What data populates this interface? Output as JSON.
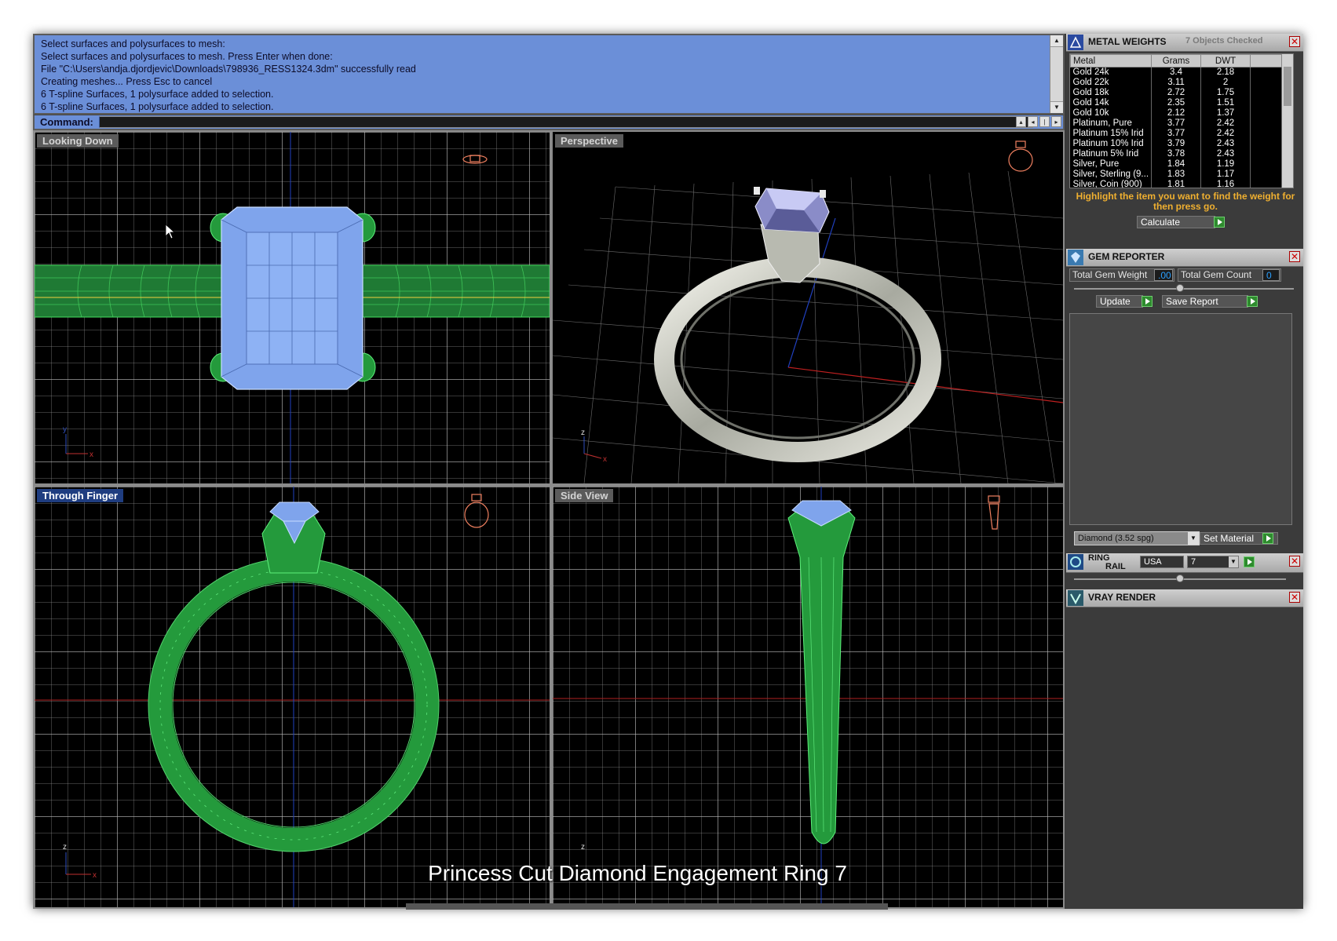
{
  "command_history": {
    "lines": [
      "Select surfaces and polysurfaces to mesh:",
      "Select surfaces and polysurfaces to mesh. Press Enter when done:",
      "File \"C:\\Users\\andja.djordjevic\\Downloads\\798936_RESS1324.3dm\" successfully read",
      "Creating meshes... Press Esc to cancel",
      "6 T-spline Surfaces, 1 polysurface added to selection.",
      "6 T-spline Surfaces, 1 polysurface added to selection."
    ]
  },
  "command_line": {
    "label": "Command:",
    "value": ""
  },
  "viewports": {
    "top": {
      "title": "Looking Down",
      "axis_x": "x",
      "axis_y": "y"
    },
    "perspective": {
      "title": "Perspective",
      "axis_x": "x",
      "axis_y": "z"
    },
    "front": {
      "title": "Through Finger",
      "axis_x": "x",
      "axis_y": "z",
      "active": true
    },
    "side": {
      "title": "Side View",
      "axis_y": "z"
    }
  },
  "caption": "Princess Cut Diamond Engagement Ring  7",
  "metal_weights": {
    "title": "METAL WEIGHTS",
    "status": "7 Objects Checked",
    "columns": [
      "Metal",
      "Grams",
      "DWT"
    ],
    "rows": [
      [
        "Gold 24k",
        "3.4",
        "2.18"
      ],
      [
        "Gold 22k",
        "3.11",
        "2"
      ],
      [
        "Gold 18k",
        "2.72",
        "1.75"
      ],
      [
        "Gold 14k",
        "2.35",
        "1.51"
      ],
      [
        "Gold 10k",
        "2.12",
        "1.37"
      ],
      [
        "Platinum, Pure",
        "3.77",
        "2.42"
      ],
      [
        "Platinum 15% Irid",
        "3.77",
        "2.42"
      ],
      [
        "Platinum 10% Irid",
        "3.79",
        "2.43"
      ],
      [
        "Platinum 5% Irid",
        "3.78",
        "2.43"
      ],
      [
        "Silver, Pure",
        "1.84",
        "1.19"
      ],
      [
        "Silver, Sterling (9...",
        "1.83",
        "1.17"
      ],
      [
        "Silver, Coin (900)",
        "1.81",
        "1.16"
      ]
    ],
    "instruction": "Highlight the item you want to find the weight for then press go.",
    "calculate_label": "Calculate"
  },
  "gem_reporter": {
    "title": "GEM REPORTER",
    "total_weight_label": "Total Gem Weight",
    "total_weight_value": ".00",
    "total_count_label": "Total Gem Count",
    "total_count_value": "0",
    "update_label": "Update",
    "save_label": "Save Report",
    "material_select": "Diamond    (3.52 spg)",
    "set_material_label": "Set Material"
  },
  "ring_rail": {
    "title_line1": "RING",
    "title_line2": "RAIL",
    "country": "USA",
    "size": "7"
  },
  "vray_render": {
    "title": "VRAY RENDER"
  },
  "colors": {
    "command_bg": "#6b8fd8",
    "wire_green": "#2fa84a",
    "gem_blue": "#7fa4ec",
    "accent_orange": "#f0b030"
  }
}
